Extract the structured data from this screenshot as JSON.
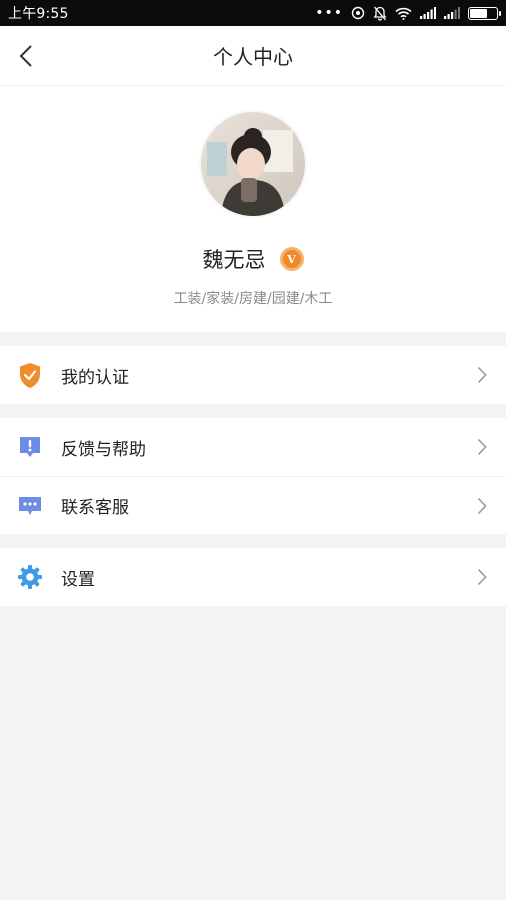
{
  "status_bar": {
    "time": "上午9:55",
    "dots": "•••"
  },
  "header": {
    "title": "个人中心"
  },
  "profile": {
    "name": "魏无忌",
    "badge": "V",
    "tags": "工装/家装/房建/园建/木工"
  },
  "menu": {
    "certification": "我的认证",
    "feedback": "反馈与帮助",
    "contact": "联系客服",
    "settings": "设置"
  },
  "colors": {
    "cert_icon": "#f08c2d",
    "feedback_icon": "#6b8de6",
    "contact_icon": "#6b8de6",
    "settings_icon": "#3f9be8"
  }
}
